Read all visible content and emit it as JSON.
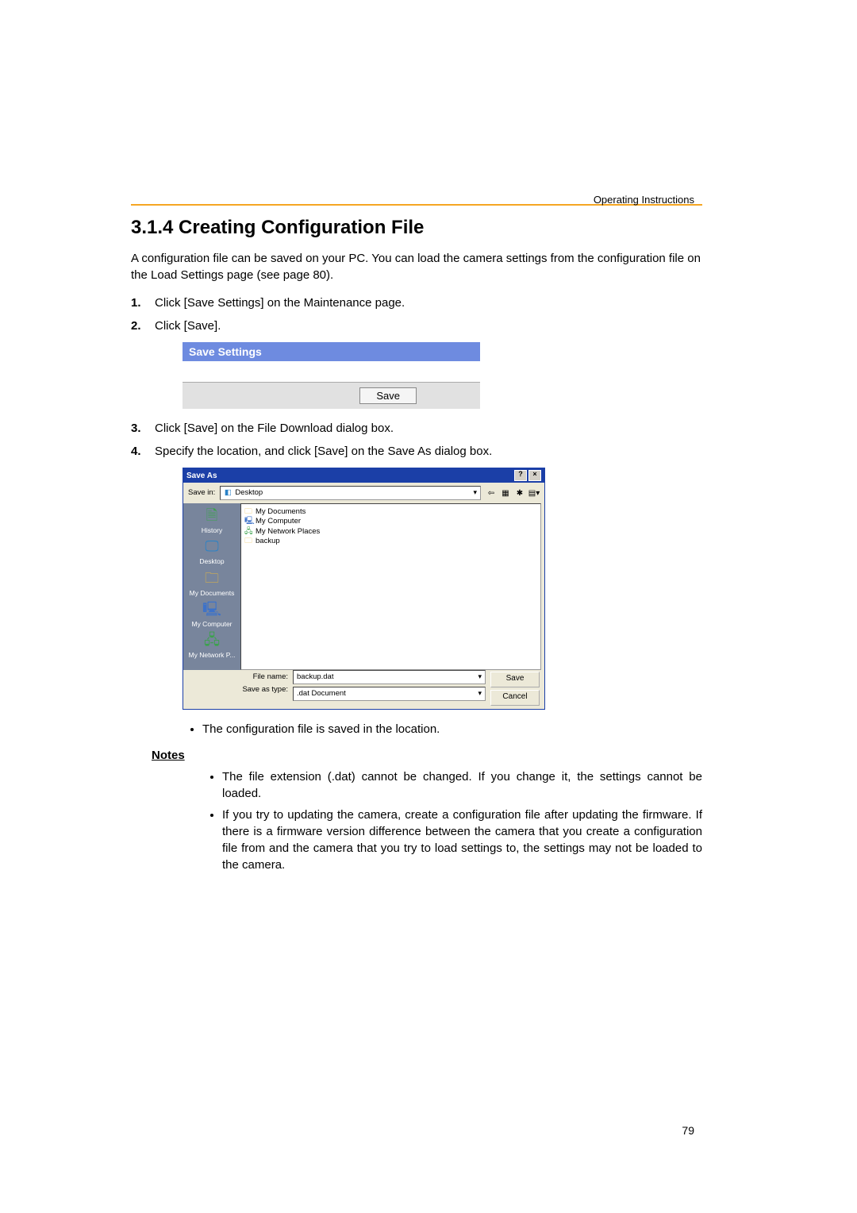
{
  "running_header": "Operating Instructions",
  "heading": "3.1.4    Creating Configuration File",
  "intro": "A configuration file can be saved on your PC. You can load the camera settings from the configuration file on the Load Settings page (see page 80).",
  "steps": {
    "s1_num": "1.",
    "s1": "Click [Save Settings] on the Maintenance page.",
    "s2_num": "2.",
    "s2": "Click [Save].",
    "s3_num": "3.",
    "s3": "Click [Save] on the File Download dialog box.",
    "s4_num": "4.",
    "s4": "Specify the location, and click [Save] on the Save As dialog box."
  },
  "save_settings": {
    "title": "Save Settings",
    "save_label": "Save"
  },
  "saveas": {
    "title": "Save As",
    "help_glyph": "?",
    "close_glyph": "×",
    "savein_label": "Save in:",
    "savein_value": "Desktop",
    "desktop_glyph": "◧",
    "toolbar_icons": {
      "back": "⇦",
      "up": "▦",
      "new": "✱",
      "views": "▤▾"
    },
    "sidebar": {
      "history_label": "History",
      "history_glyph": "🗎",
      "desktop_label": "Desktop",
      "desktop_glyph": "🖵",
      "mydocuments_label": "My Documents",
      "mydocuments_glyph": "🗀",
      "mycomputer_label": "My Computer",
      "mycomputer_glyph": "🖳",
      "mynetwork_label": "My Network P...",
      "mynetwork_glyph": "🖧"
    },
    "list": {
      "item0": "My Documents",
      "item1": "My Computer",
      "item2": "My Network Places",
      "item3": "backup"
    },
    "filename_label": "File name:",
    "filename_value": "backup.dat",
    "savetype_label": "Save as type:",
    "savetype_value": ".dat Document",
    "save_label": "Save",
    "cancel_label": "Cancel",
    "dropdown_glyph": "▾"
  },
  "sub_bullet1": "The configuration file is saved in the location.",
  "notes_heading": "Notes",
  "note1": "The file extension (.dat) cannot be changed. If you change it, the settings cannot be loaded.",
  "note2": "If you try to updating the camera, create a configuration file after updating the firmware. If there is a firmware version difference between the camera that you create a configuration file from and the camera that you try to load settings to, the settings may not be loaded to the camera.",
  "page_number": "79"
}
